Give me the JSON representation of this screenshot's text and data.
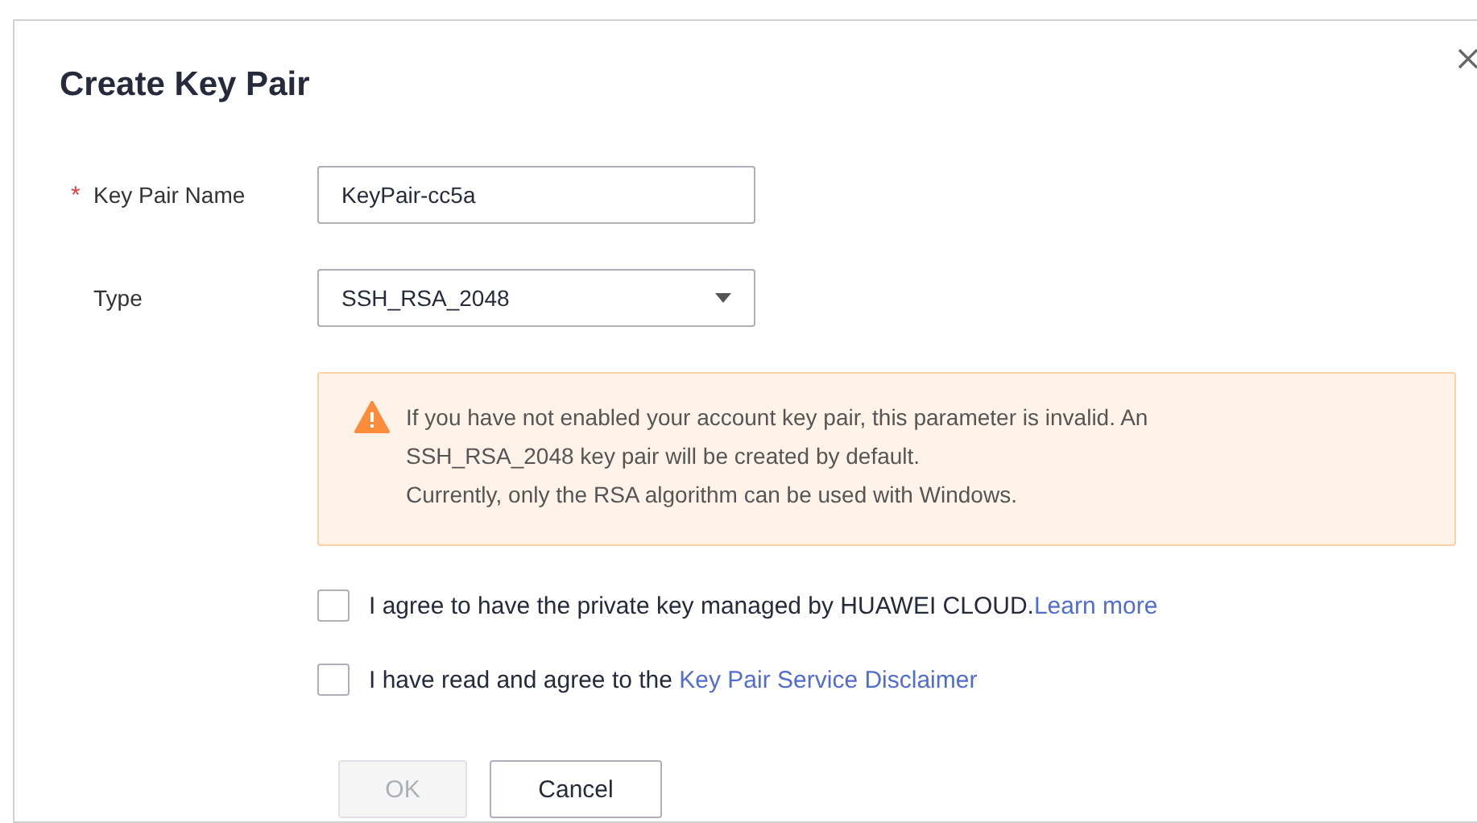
{
  "dialog": {
    "title": "Create Key Pair"
  },
  "fields": [
    {
      "kind": "input",
      "label": "Key Pair Name",
      "required_mark": "*",
      "value": "KeyPair-cc5a"
    },
    {
      "kind": "select",
      "label": "Type",
      "value": "SSH_RSA_2048"
    }
  ],
  "warning": {
    "lines": [
      "If you have not enabled your account key pair, this parameter is invalid. An SSH_RSA_2048 key pair will be created by default.",
      "Currently, only the RSA algorithm can be used with Windows."
    ]
  },
  "agreements": [
    {
      "text": "I agree to have the private key managed by HUAWEI CLOUD.",
      "link": "Learn more",
      "checked": false
    },
    {
      "text": "I have read and agree to the ",
      "link": "Key Pair Service Disclaimer",
      "checked": false
    }
  ],
  "buttons": [
    {
      "label": "OK",
      "kind": "primary",
      "disabled": true
    },
    {
      "label": "Cancel",
      "kind": "secondary",
      "disabled": false
    }
  ]
}
